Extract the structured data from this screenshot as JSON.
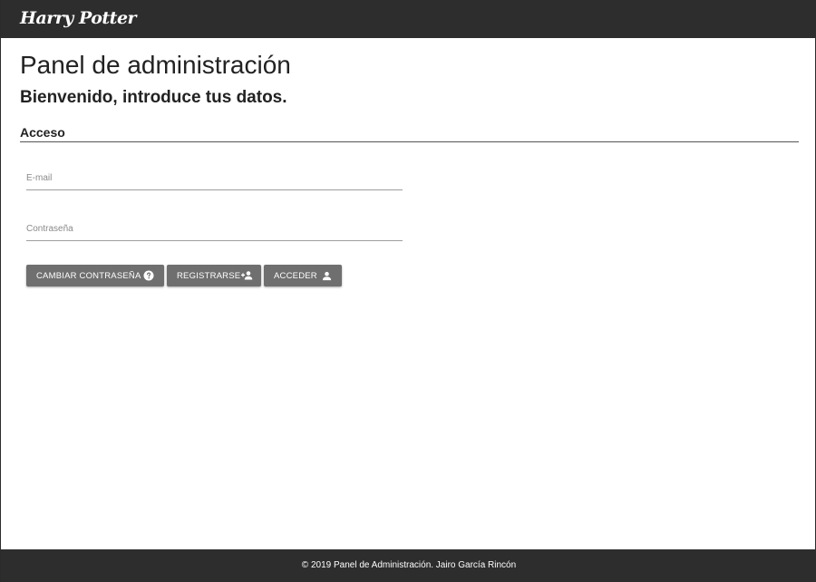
{
  "header": {
    "logo_text": "Harry Potter"
  },
  "main": {
    "title": "Panel de administración",
    "subtitle": "Bienvenido, introduce tus datos.",
    "section_heading": "Acceso"
  },
  "form": {
    "email": {
      "placeholder": "E-mail",
      "value": ""
    },
    "password": {
      "placeholder": "Contraseña",
      "value": ""
    }
  },
  "buttons": {
    "change_password": {
      "label": "CAMBIAR CONTRASEÑA",
      "icon": "help-circle-icon"
    },
    "register": {
      "label": "REGISTRARSE",
      "icon": "person-add-icon"
    },
    "login": {
      "label": "ACCEDER",
      "icon": "person-icon"
    }
  },
  "footer": {
    "text": "© 2019 Panel de Administración. Jairo García Rincón"
  },
  "colors": {
    "topbar": "#2d2d2d",
    "button": "#6f6f6f",
    "footer": "#2d2d2d"
  }
}
